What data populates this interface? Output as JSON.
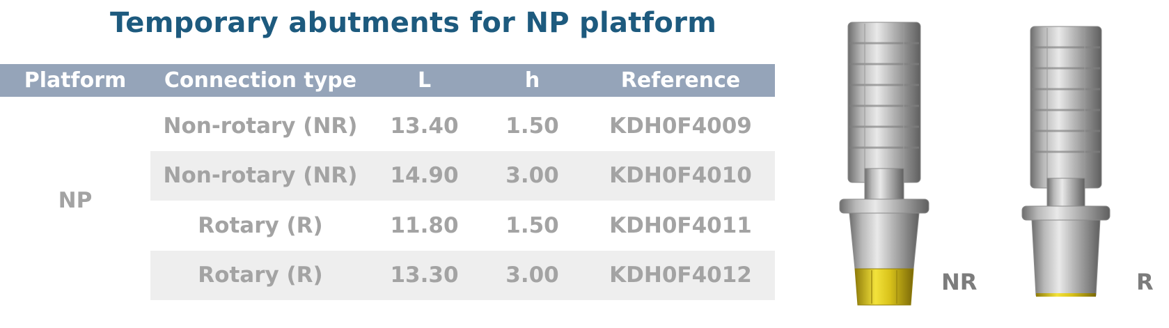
{
  "title": "Temporary abutments for NP platform",
  "table": {
    "headers": [
      "Platform",
      "Connection type",
      "L",
      "h",
      "Reference"
    ],
    "platform": "NP",
    "rows": [
      {
        "connection": "Non-rotary (NR)",
        "L": "13.40",
        "h": "1.50",
        "reference": "KDH0F4009"
      },
      {
        "connection": "Non-rotary (NR)",
        "L": "14.90",
        "h": "3.00",
        "reference": "KDH0F4010"
      },
      {
        "connection": "Rotary (R)",
        "L": "11.80",
        "h": "1.50",
        "reference": "KDH0F4011"
      },
      {
        "connection": "Rotary (R)",
        "L": "13.30",
        "h": "3.00",
        "reference": "KDH0F4012"
      }
    ]
  },
  "products": {
    "nr_label": "NR",
    "r_label": "R"
  },
  "colors": {
    "title": "#1d5a7e",
    "header_bg": "#95a4b9",
    "row_text": "#a3a3a3",
    "row_shade": "#eeeeee",
    "gold": "#d8c21a"
  }
}
